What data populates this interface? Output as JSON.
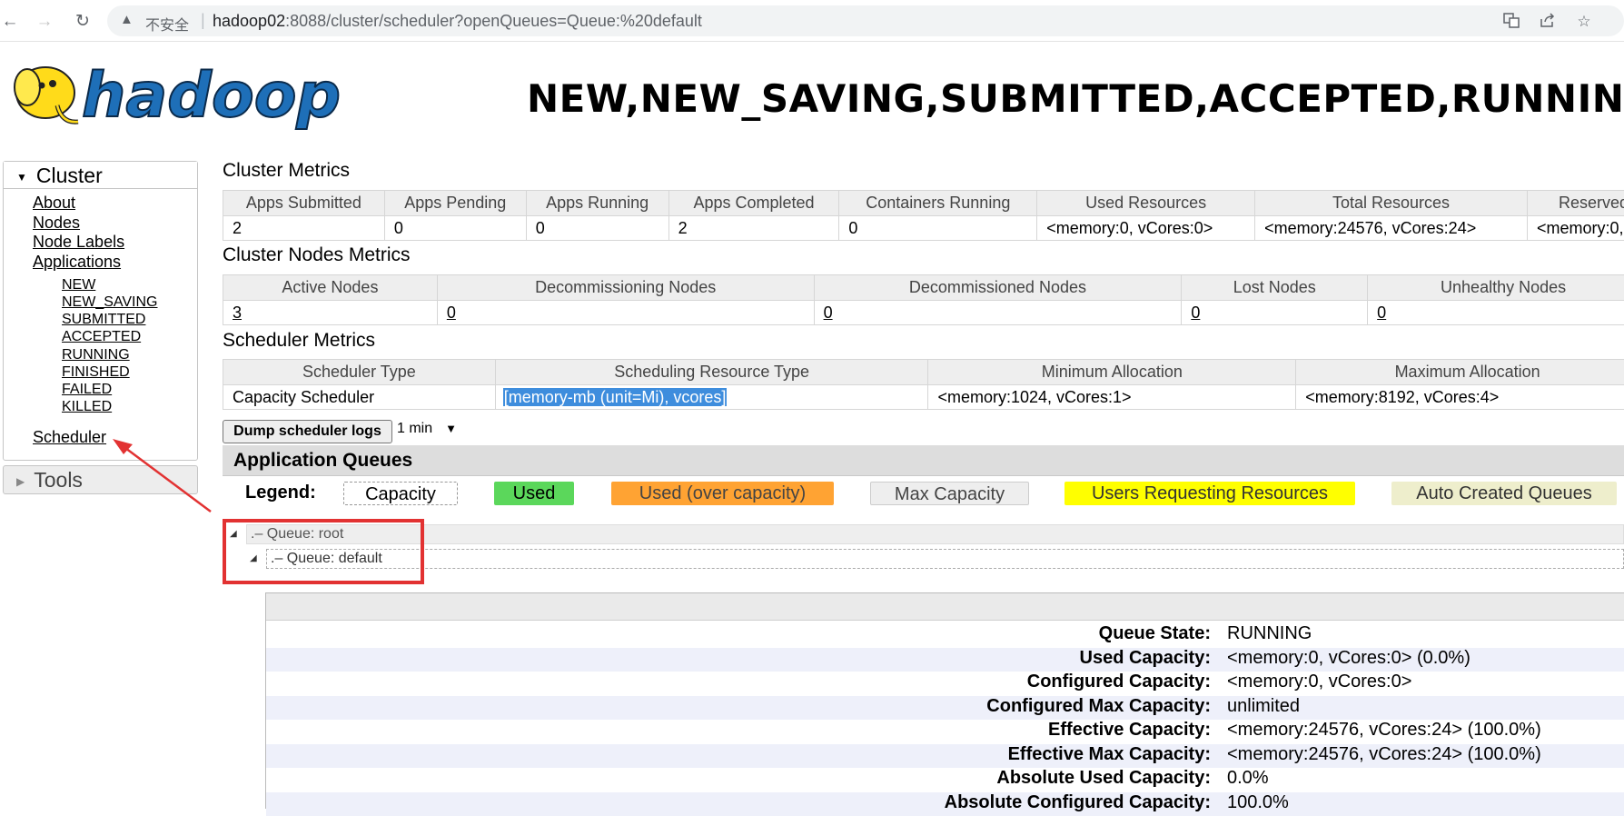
{
  "browser": {
    "insecure_label": "不安全",
    "url_host": "hadoop02",
    "url_rest": ":8088/cluster/scheduler?openQueues=Queue:%20default"
  },
  "header": {
    "logo_text": "hadoop",
    "title": "NEW,NEW_SAVING,SUBMITTED,ACCEPTED,RUNNING A"
  },
  "sidebar": {
    "cluster_label": "Cluster",
    "links": [
      "About",
      "Nodes",
      "Node Labels",
      "Applications"
    ],
    "app_states": [
      "NEW",
      "NEW_SAVING",
      "SUBMITTED",
      "ACCEPTED",
      "RUNNING",
      "FINISHED",
      "FAILED",
      "KILLED"
    ],
    "scheduler_label": "Scheduler",
    "tools_label": "Tools"
  },
  "cluster_metrics": {
    "title": "Cluster Metrics",
    "headers": [
      "Apps Submitted",
      "Apps Pending",
      "Apps Running",
      "Apps Completed",
      "Containers Running",
      "Used Resources",
      "Total Resources",
      "Reserved"
    ],
    "values": [
      "2",
      "0",
      "0",
      "2",
      "0",
      "<memory:0, vCores:0>",
      "<memory:24576, vCores:24>",
      "<memory:0,"
    ]
  },
  "nodes_metrics": {
    "title": "Cluster Nodes Metrics",
    "headers": [
      "Active Nodes",
      "Decommissioning Nodes",
      "Decommissioned Nodes",
      "Lost Nodes",
      "Unhealthy Nodes"
    ],
    "values": [
      "3",
      "0",
      "0",
      "0",
      "0"
    ]
  },
  "scheduler_metrics": {
    "title": "Scheduler Metrics",
    "headers": [
      "Scheduler Type",
      "Scheduling Resource Type",
      "Minimum Allocation",
      "Maximum Allocation"
    ],
    "values": [
      "Capacity Scheduler",
      "[memory-mb (unit=Mi), vcores]",
      "<memory:1024, vCores:1>",
      "<memory:8192, vCores:4>"
    ]
  },
  "dump": {
    "button": "Dump scheduler logs",
    "interval": "1 min"
  },
  "queues": {
    "title": "Application Queues",
    "legend_label": "Legend:",
    "legend": [
      "Capacity",
      "Used",
      "Used (over capacity)",
      "Max Capacity",
      "Users Requesting Resources",
      "Auto Created Queues"
    ],
    "legend_colors": [
      "#ffffff",
      "#5bd75b",
      "#ffa333",
      "#eeeeee",
      "#ffff00",
      "#eeeecc"
    ],
    "root": "Queue: root",
    "default": "Queue: default",
    "root_marker": ".–",
    "default_marker": ".–"
  },
  "queue_details": [
    {
      "key": "Queue State:",
      "value": "RUNNING"
    },
    {
      "key": "Used Capacity:",
      "value": "<memory:0, vCores:0> (0.0%)"
    },
    {
      "key": "Configured Capacity:",
      "value": "<memory:0, vCores:0>"
    },
    {
      "key": "Configured Max Capacity:",
      "value": "unlimited"
    },
    {
      "key": "Effective Capacity:",
      "value": "<memory:24576, vCores:24> (100.0%)"
    },
    {
      "key": "Effective Max Capacity:",
      "value": "<memory:24576, vCores:24> (100.0%)"
    },
    {
      "key": "Absolute Used Capacity:",
      "value": "0.0%"
    },
    {
      "key": "Absolute Configured Capacity:",
      "value": "100.0%"
    }
  ]
}
